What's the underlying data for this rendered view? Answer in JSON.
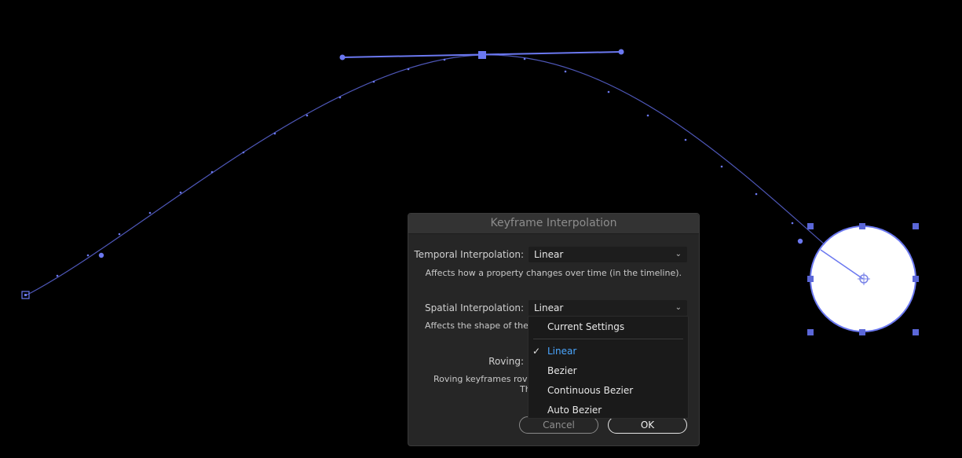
{
  "dialog": {
    "title": "Keyframe Interpolation",
    "temporal_label": "Temporal Interpolation:",
    "temporal_value": "Linear",
    "temporal_help": "Affects how a property changes over time (in the timeline).",
    "spatial_label": "Spatial Interpolation:",
    "spatial_value": "Linear",
    "spatial_help": "Affects the shape of the p",
    "roving_label": "Roving:",
    "roving_help_line1": "Roving keyframes rove",
    "roving_help_line2": "Th",
    "cancel_label": "Cancel",
    "ok_label": "OK"
  },
  "dropdown": {
    "items": [
      {
        "label": "Current Settings",
        "checked": false
      },
      {
        "label": "Linear",
        "checked": true
      },
      {
        "label": "Bezier",
        "checked": false
      },
      {
        "label": "Continuous Bezier",
        "checked": false
      },
      {
        "label": "Auto Bezier",
        "checked": false
      }
    ],
    "check_glyph": "✓"
  },
  "colors": {
    "path": "#5b67d8",
    "handle": "#6b78f0",
    "selection": "#6b78f0",
    "shape_fill": "#ffffff",
    "accent_selected": "#4aa6ff"
  }
}
